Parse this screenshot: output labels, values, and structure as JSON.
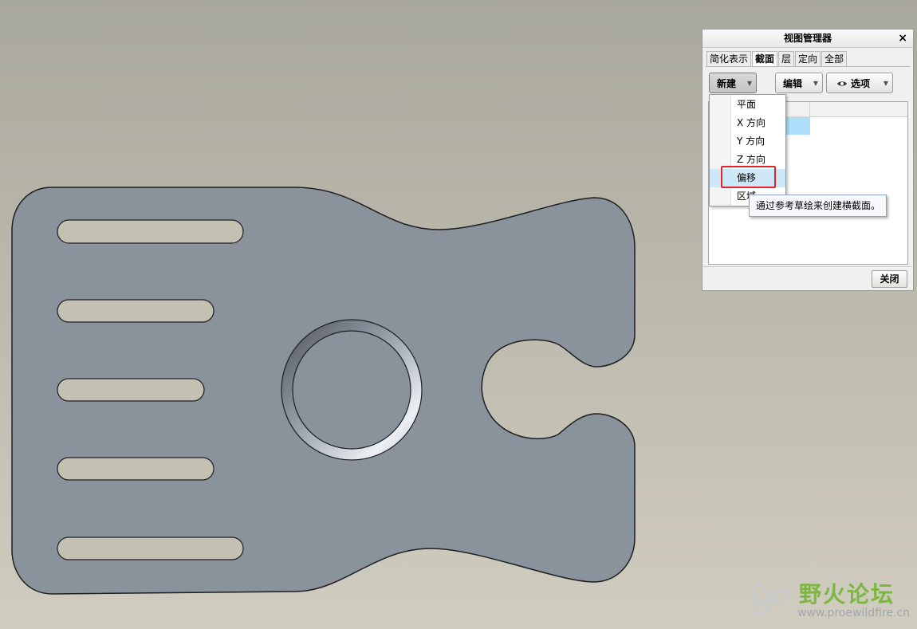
{
  "panel": {
    "title": "视图管理器",
    "close_glyph": "×",
    "tabs": [
      {
        "label": "简化表示",
        "active": false
      },
      {
        "label": "截面",
        "active": true
      },
      {
        "label": "层",
        "active": false
      },
      {
        "label": "定向",
        "active": false
      },
      {
        "label": "全部",
        "active": false
      }
    ],
    "new_button": "新建",
    "edit_button": "编辑",
    "options_button": "选项",
    "close_button": "关闭"
  },
  "dropdown": {
    "items": [
      "平面",
      "X 方向",
      "Y 方向",
      "Z 方向",
      "偏移",
      "区域"
    ],
    "highlighted": "偏移"
  },
  "tooltip": {
    "text": "通过参考草绘来创建横截面。"
  },
  "watermark": {
    "name": "野火论坛",
    "url": "www.proewildfire.cn"
  },
  "icons": {
    "dropdown_arrow": "dropdown-arrow-icon",
    "eye": "eye-icon",
    "close": "close-icon"
  },
  "colors": {
    "part_fill": "#8a929b",
    "part_stroke": "#1d1f22",
    "slot_fill": "#c4c1b3",
    "highlight_box": "#e0252b",
    "watermark_green": "#71b32f"
  }
}
